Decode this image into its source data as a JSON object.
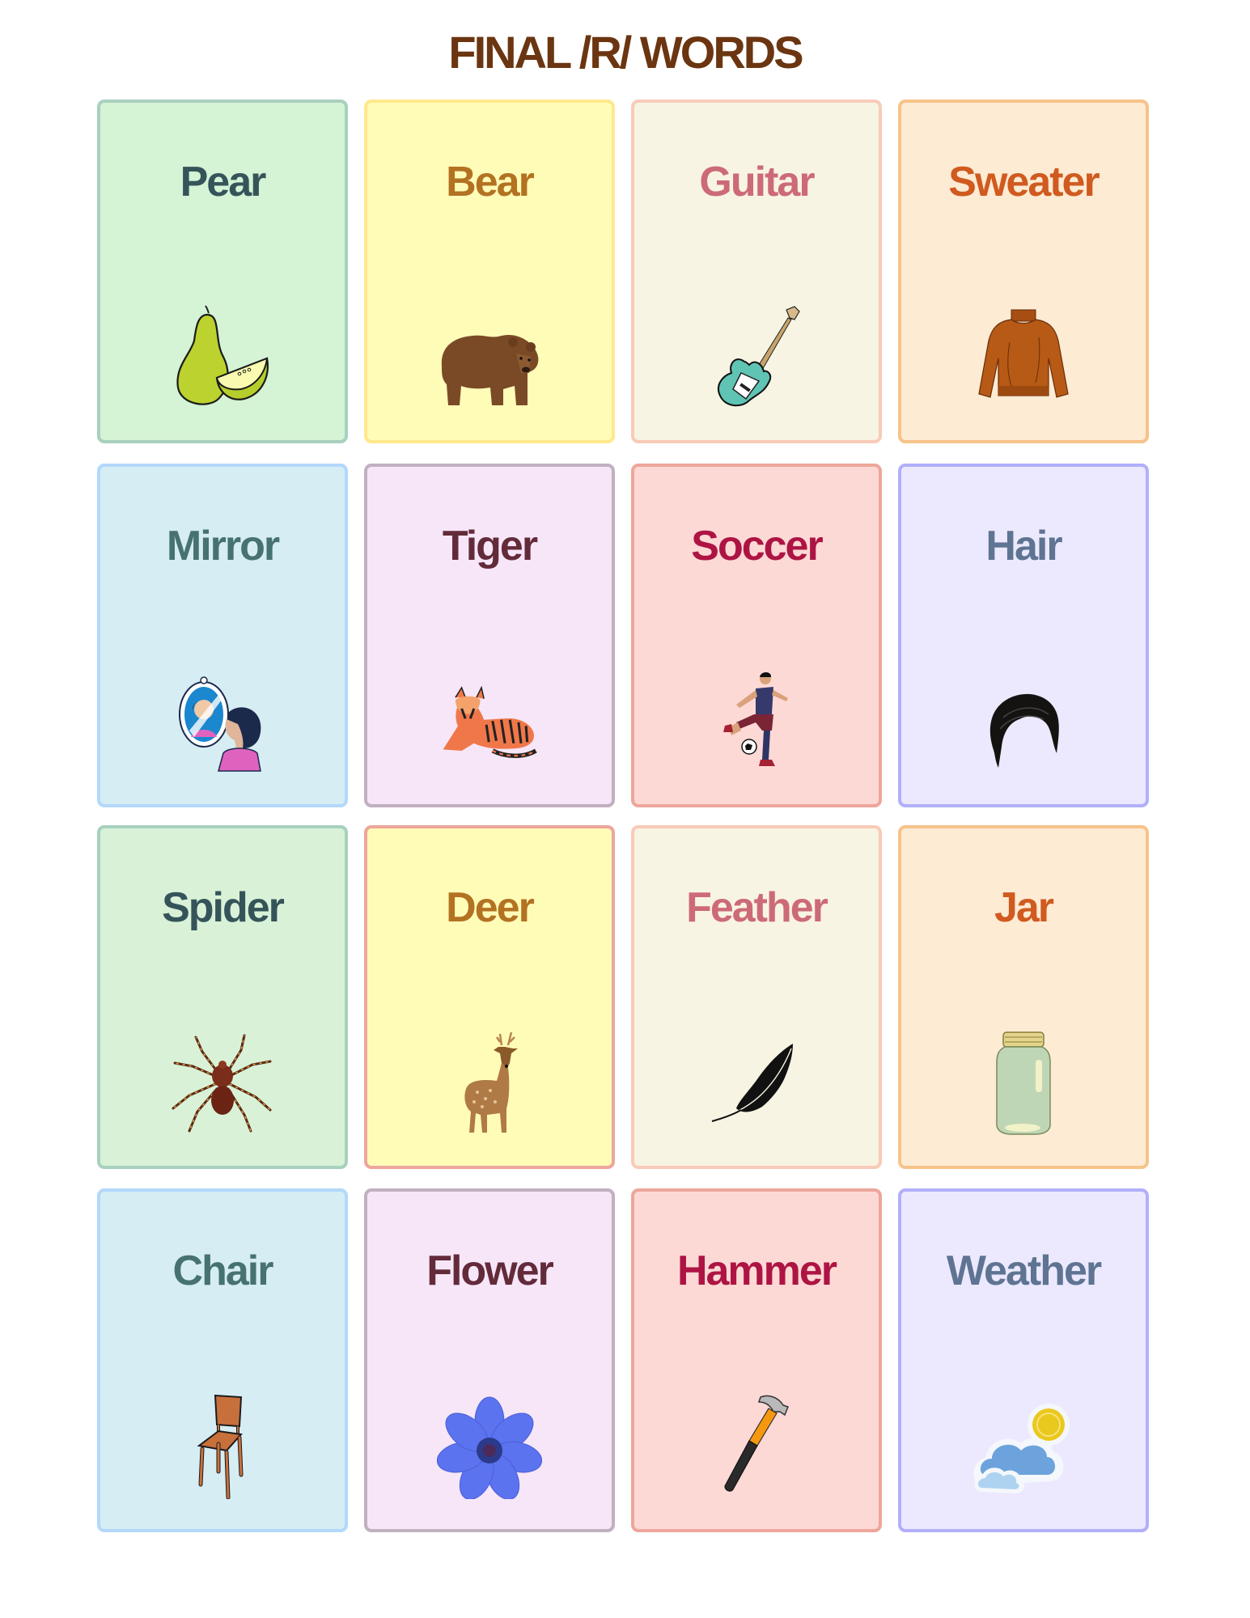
{
  "page": {
    "title": "FINAL /R/ WORDS",
    "title_color": "#6a3510"
  },
  "cards": [
    {
      "word": "Pear",
      "icon": "pear-icon",
      "text_color": "#35545a",
      "bg": "#d5f3d5",
      "border": "#a8d0be"
    },
    {
      "word": "Bear",
      "icon": "bear-icon",
      "text_color": "#b37222",
      "bg": "#fffcb8",
      "border": "#ffe88c"
    },
    {
      "word": "Guitar",
      "icon": "guitar-icon",
      "text_color": "#cd6a78",
      "bg": "#f8f4e3",
      "border": "#f8cbb8"
    },
    {
      "word": "Sweater",
      "icon": "sweater-icon",
      "text_color": "#d05a1f",
      "bg": "#fdebd4",
      "border": "#f7c38a"
    },
    {
      "word": "Mirror",
      "icon": "mirror-icon",
      "text_color": "#467270",
      "bg": "#d6edf4",
      "border": "#b3d8fb"
    },
    {
      "word": "Tiger",
      "icon": "tiger-icon",
      "text_color": "#632b3a",
      "bg": "#f6e6f8",
      "border": "#c1b0c0"
    },
    {
      "word": "Soccer",
      "icon": "soccer-player-icon",
      "text_color": "#ad1443",
      "bg": "#fdd9d6",
      "border": "#eda69b"
    },
    {
      "word": "Hair",
      "icon": "hair-icon",
      "text_color": "#5e7492",
      "bg": "#ece9fe",
      "border": "#b2affa"
    },
    {
      "word": "Spider",
      "icon": "spider-icon",
      "text_color": "#35545a",
      "bg": "#d9f2d7",
      "border": "#a8d0be"
    },
    {
      "word": "Deer",
      "icon": "deer-icon",
      "text_color": "#b37222",
      "bg": "#fffcb8",
      "border": "#eda69b"
    },
    {
      "word": "Feather",
      "icon": "feather-icon",
      "text_color": "#cd6a78",
      "bg": "#f8f4e3",
      "border": "#f8cbb8"
    },
    {
      "word": "Jar",
      "icon": "jar-icon",
      "text_color": "#d05a1f",
      "bg": "#fdebd4",
      "border": "#f7c38a"
    },
    {
      "word": "Chair",
      "icon": "chair-icon",
      "text_color": "#467270",
      "bg": "#d6edf4",
      "border": "#b3d8fb"
    },
    {
      "word": "Flower",
      "icon": "flower-icon",
      "text_color": "#632b3a",
      "bg": "#f6e6f8",
      "border": "#c1b0c0"
    },
    {
      "word": "Hammer",
      "icon": "hammer-icon",
      "text_color": "#ad1443",
      "bg": "#fdd9d6",
      "border": "#eda69b"
    },
    {
      "word": "Weather",
      "icon": "weather-icon",
      "text_color": "#5e7492",
      "bg": "#ece9fe",
      "border": "#b2affa"
    }
  ]
}
